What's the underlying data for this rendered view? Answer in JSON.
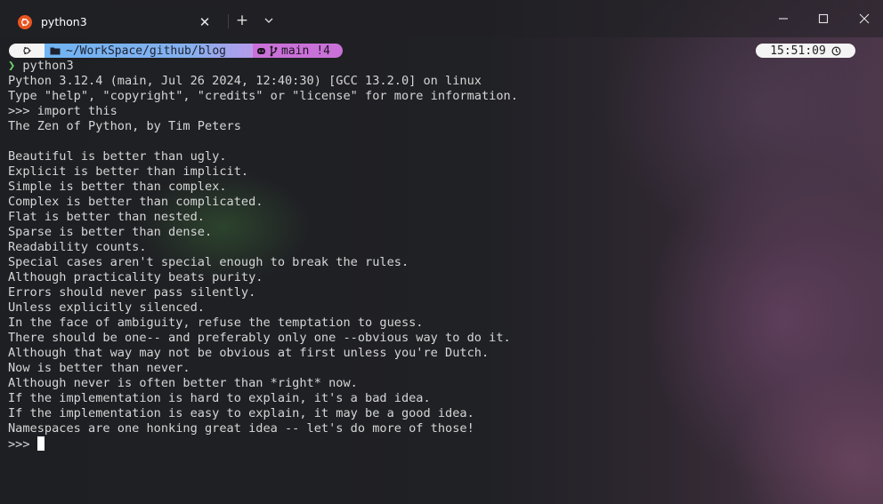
{
  "tab": {
    "title": "python3",
    "icon": "ubuntu-icon",
    "close_symbol": "✕",
    "new_tab_symbol": "+",
    "dropdown_icon": "chevron-down-icon"
  },
  "window_controls": [
    "minimize-icon",
    "maximize-icon",
    "close-icon"
  ],
  "prompt": {
    "os_icon": "linux-icon",
    "path": "~/WorkSpace/github/blog",
    "git_branch": "main",
    "git_status": "!4",
    "time": "15:51:09"
  },
  "colors": {
    "os_segment": "#f4f4f4",
    "path_segment": "#6fb4f3",
    "git_segment": "#c971d8",
    "prompt_arrow": "#6cd66c",
    "terminal_text": "#d6d6d6"
  },
  "terminal": {
    "command": "python3",
    "prompt_symbol": "❯",
    "lines": [
      "Python 3.12.4 (main, Jul 26 2024, 12:40:30) [GCC 13.2.0] on linux",
      "Type \"help\", \"copyright\", \"credits\" or \"license\" for more information.",
      ">>> import this",
      "The Zen of Python, by Tim Peters",
      "",
      "Beautiful is better than ugly.",
      "Explicit is better than implicit.",
      "Simple is better than complex.",
      "Complex is better than complicated.",
      "Flat is better than nested.",
      "Sparse is better than dense.",
      "Readability counts.",
      "Special cases aren't special enough to break the rules.",
      "Although practicality beats purity.",
      "Errors should never pass silently.",
      "Unless explicitly silenced.",
      "In the face of ambiguity, refuse the temptation to guess.",
      "There should be one-- and preferably only one --obvious way to do it.",
      "Although that way may not be obvious at first unless you're Dutch.",
      "Now is better than never.",
      "Although never is often better than *right* now.",
      "If the implementation is hard to explain, it's a bad idea.",
      "If the implementation is easy to explain, it may be a good idea.",
      "Namespaces are one honking great idea -- let's do more of those!"
    ],
    "current_prompt": ">>> "
  }
}
